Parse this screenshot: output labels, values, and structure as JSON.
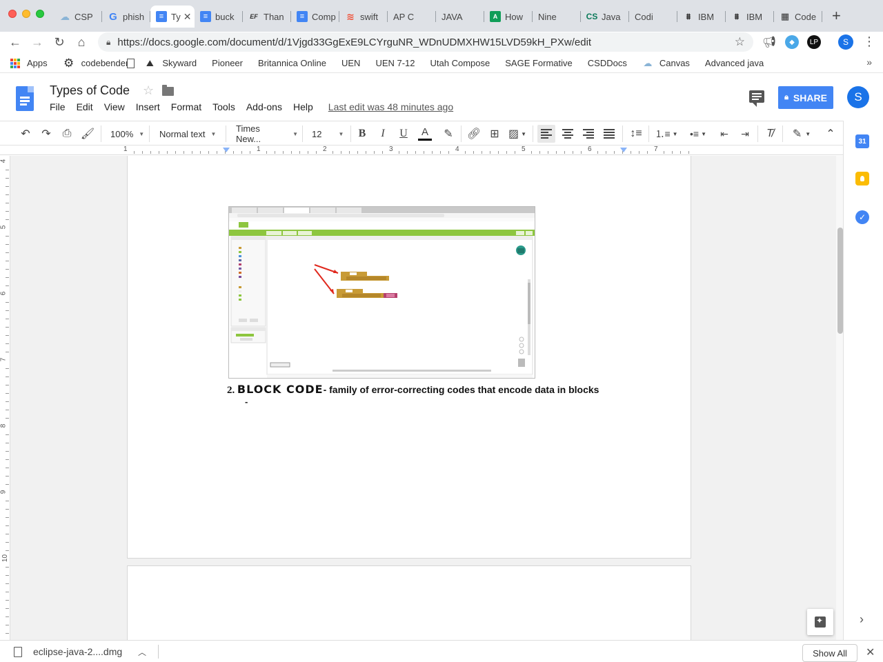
{
  "browser": {
    "tabs": [
      {
        "label": "CSP",
        "icon": "cloud-icon",
        "glyph": "☁",
        "kind": "cloud"
      },
      {
        "label": "phish",
        "icon": "google-icon",
        "glyph": "G",
        "kind": "g"
      },
      {
        "label": "Ty",
        "icon": "google-docs-icon",
        "glyph": "≡",
        "kind": "doc",
        "active": true
      },
      {
        "label": "buck",
        "icon": "google-docs-icon",
        "glyph": "≡",
        "kind": "doc"
      },
      {
        "label": "Than",
        "icon": "ef-icon",
        "glyph": "EF",
        "kind": "ef"
      },
      {
        "label": "Comp",
        "icon": "google-docs-icon",
        "glyph": "≡",
        "kind": "doc"
      },
      {
        "label": "swift",
        "icon": "stack-overflow-icon",
        "glyph": "≋",
        "kind": "swift"
      },
      {
        "label": "AP C",
        "icon": "page-icon",
        "glyph": "",
        "kind": "page"
      },
      {
        "label": "JAVA",
        "icon": "page-icon",
        "glyph": "",
        "kind": "page"
      },
      {
        "label": "How",
        "icon": "codecademy-icon",
        "glyph": "A",
        "kind": "ck"
      },
      {
        "label": "Nine",
        "icon": "page-icon",
        "glyph": "",
        "kind": "page"
      },
      {
        "label": "Java",
        "icon": "cs-icon",
        "glyph": "CS",
        "kind": "cs"
      },
      {
        "label": "Codi",
        "icon": "page-icon",
        "glyph": "",
        "kind": "page"
      },
      {
        "label": "IBM",
        "icon": "ibm-icon",
        "glyph": "⩩",
        "kind": "ibm"
      },
      {
        "label": "IBM",
        "icon": "ibm-icon",
        "glyph": "⩩",
        "kind": "ibm"
      },
      {
        "label": "Code",
        "icon": "code-grid-icon",
        "glyph": "▦",
        "kind": "code"
      }
    ],
    "active_tab_close": "✕",
    "new_tab": "+",
    "url": "https://docs.google.com/document/d/1Vjgd33GgExE9LCYrguNR_WDnUDMXHW15LVD59kH_PXw/edit",
    "profile_initial": "S",
    "bookmarks": [
      {
        "label": "Apps",
        "icon": "apps-grid-icon",
        "kind": "grid"
      },
      {
        "label": "codebender",
        "icon": "gear-icon",
        "kind": "gear"
      },
      {
        "label": "Skyward",
        "icon": "skyward-icon",
        "kind": "sky"
      },
      {
        "label": "Pioneer",
        "icon": "page-icon",
        "kind": "page"
      },
      {
        "label": "Britannica Online",
        "icon": "page-icon",
        "kind": "page"
      },
      {
        "label": "UEN",
        "icon": "page-icon",
        "kind": "page"
      },
      {
        "label": "UEN 7-12",
        "icon": "page-icon",
        "kind": "page"
      },
      {
        "label": "Utah Compose",
        "icon": "page-icon",
        "kind": "page"
      },
      {
        "label": "SAGE Formative",
        "icon": "page-icon",
        "kind": "page"
      },
      {
        "label": "CSDDocs",
        "icon": "page-icon",
        "kind": "page"
      },
      {
        "label": "Canvas",
        "icon": "cloud-icon",
        "kind": "cloud"
      },
      {
        "label": "Advanced java",
        "icon": "page-icon",
        "kind": "page"
      }
    ],
    "bookmarks_more": "»"
  },
  "docs": {
    "title": "Types of Code",
    "menu": [
      "File",
      "Edit",
      "View",
      "Insert",
      "Format",
      "Tools",
      "Add-ons",
      "Help"
    ],
    "last_edit": "Last edit was 48 minutes ago",
    "share_label": "SHARE",
    "user_initial": "S",
    "toolbar": {
      "zoom": "100%",
      "style": "Normal text",
      "font": "Times New...",
      "size": "12"
    },
    "ruler_numbers": [
      "1",
      "1",
      "2",
      "3",
      "4",
      "5",
      "6",
      "7"
    ],
    "vruler_numbers": [
      "4",
      "5",
      "6",
      "7",
      "8",
      "9",
      "10"
    ],
    "calendar_day": "31"
  },
  "document": {
    "heading_number": "2.",
    "heading_title": "BLOCK CODE",
    "heading_desc": "- family of error-correcting codes that encode data in blocks",
    "dash": "-"
  },
  "download_bar": {
    "filename": "eclipse-java-2....dmg",
    "show_all": "Show All"
  },
  "colors": {
    "accent": "#4285f4",
    "appinventor_green": "#8dc63f",
    "block_gold": "#c89b36",
    "block_text": "#b5416e",
    "arrow_red": "#e0281d"
  }
}
